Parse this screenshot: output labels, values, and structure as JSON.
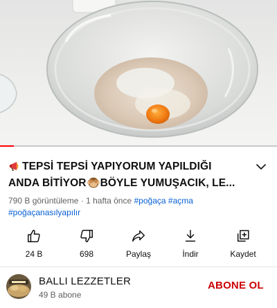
{
  "video": {
    "progress_fraction": 0.05,
    "accent_color": "#ff0000"
  },
  "title": {
    "line1": "TEPSİ TEPSİ YAPIYORUM YAPILDIĞI",
    "line2_before": "ANDA BİTİYOR",
    "line2_after": "BÖYLE YUMUŞACIK, LE...",
    "leading_icon": "megaphone-emoji",
    "inline_icon": "see-no-evil-monkey-emoji"
  },
  "meta": {
    "views": "790 B görüntüleme",
    "separator": "·",
    "age": "1 hafta önce",
    "hashtags": [
      "#poğaça",
      "#açma",
      "#poğaçanasılyapılır"
    ]
  },
  "actions": {
    "like_count": "24 B",
    "dislike_count": "698",
    "share_label": "Paylaş",
    "download_label": "İndir",
    "save_label": "Kaydet"
  },
  "channel": {
    "name": "BALLI LEZZETLER",
    "subscribers": "49 B abone",
    "subscribe_label": "ABONE OL",
    "subscribe_color": "#cc0000"
  }
}
